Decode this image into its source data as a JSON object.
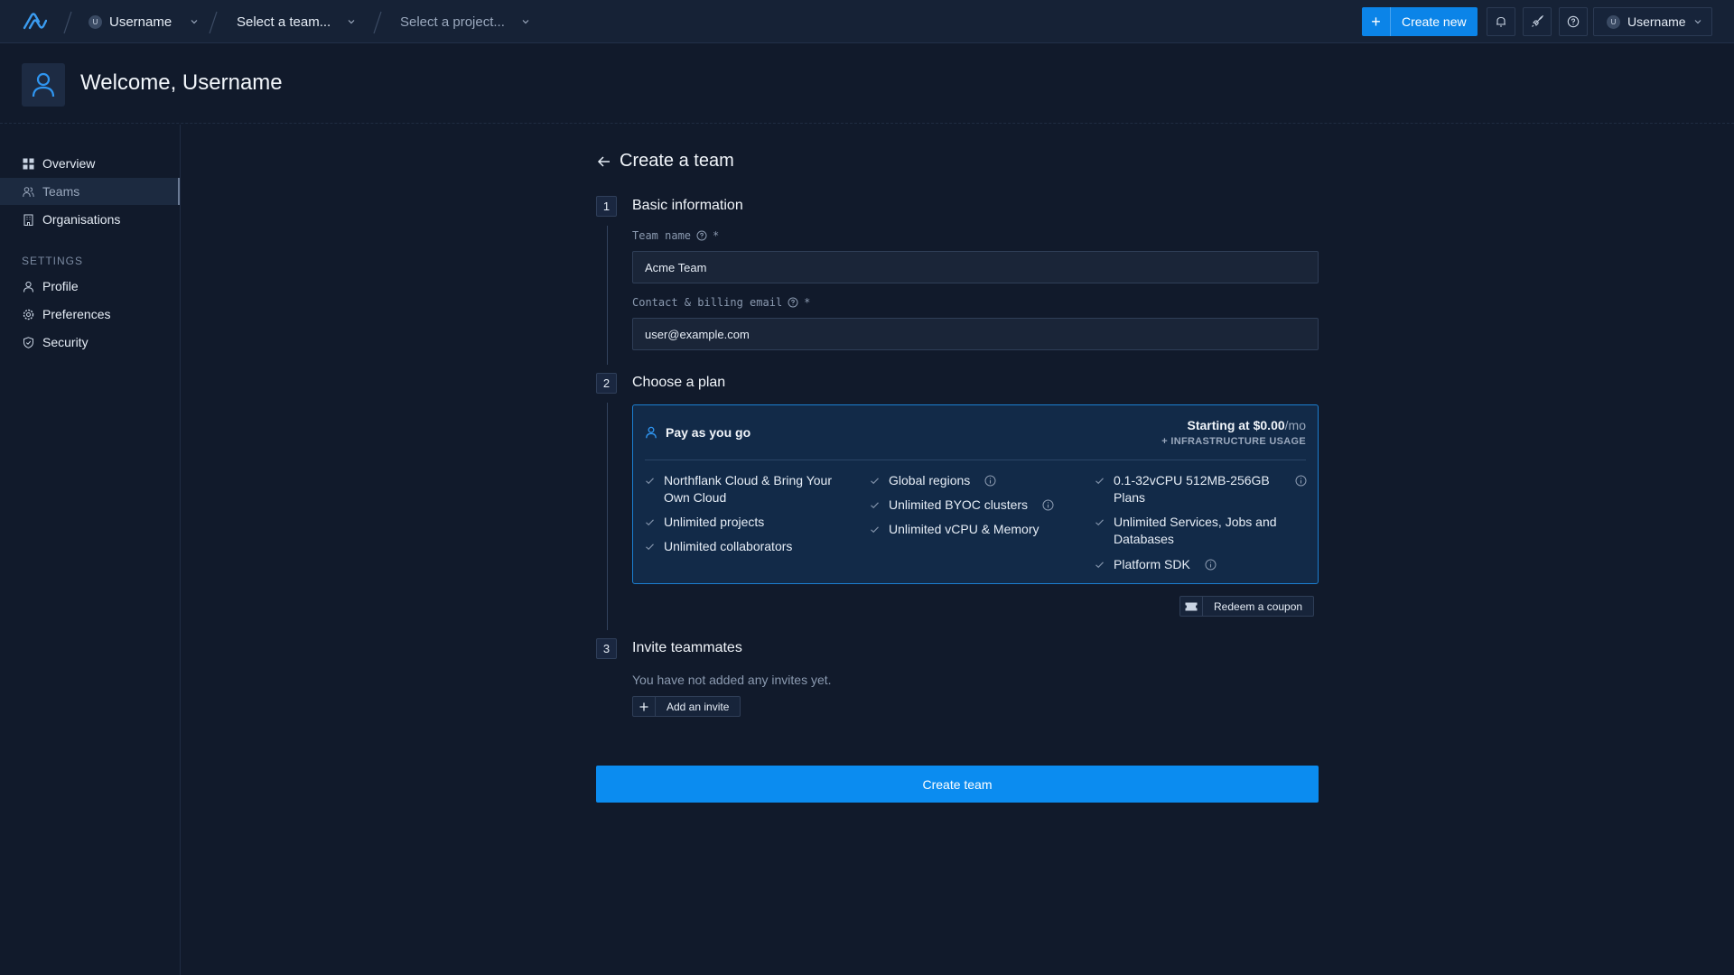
{
  "topbar": {
    "user_crumb": "Username",
    "user_crumb_initial": "U",
    "team_select": "Select a team...",
    "project_select": "Select a project...",
    "create_new_label": "Create new",
    "user_menu_label": "Username",
    "user_menu_initial": "U",
    "accent_color": "#0b84e8"
  },
  "header": {
    "welcome": "Welcome, Username"
  },
  "sidebar": {
    "items": [
      {
        "label": "Overview",
        "icon": "grid-icon"
      },
      {
        "label": "Teams",
        "icon": "users-icon",
        "active": true
      },
      {
        "label": "Organisations",
        "icon": "building-icon"
      }
    ],
    "settings_heading": "SETTINGS",
    "settings_items": [
      {
        "label": "Profile",
        "icon": "user-icon"
      },
      {
        "label": "Preferences",
        "icon": "gear-icon"
      },
      {
        "label": "Security",
        "icon": "shield-icon"
      }
    ]
  },
  "main": {
    "title": "Create a team",
    "steps": [
      {
        "number": "1",
        "title": "Basic information"
      },
      {
        "number": "2",
        "title": "Choose a plan"
      },
      {
        "number": "3",
        "title": "Invite teammates"
      }
    ],
    "team_name_label": "Team name",
    "team_name_value": "Acme Team",
    "email_label": "Contact & billing email",
    "email_value": "user@example.com",
    "required_marker": "*",
    "plan": {
      "name": "Pay as you go",
      "price_prefix": "Starting at",
      "price_value": "$0.00",
      "price_unit": "/mo",
      "infra_note": "+ INFRASTRUCTURE USAGE",
      "features_col1": [
        "Northflank Cloud & Bring Your Own Cloud",
        "Unlimited projects",
        "Unlimited collaborators"
      ],
      "features_col2": [
        "Global regions",
        "Unlimited BYOC clusters",
        "Unlimited vCPU & Memory"
      ],
      "features_col3": [
        "0.1-32vCPU 512MB-256GB Plans",
        "Unlimited Services, Jobs and Databases",
        "Platform SDK"
      ]
    },
    "redeem_coupon_label": "Redeem a coupon",
    "no_invites_text": "You have not added any invites yet.",
    "add_invite_label": "Add an invite",
    "create_team_label": "Create team"
  }
}
